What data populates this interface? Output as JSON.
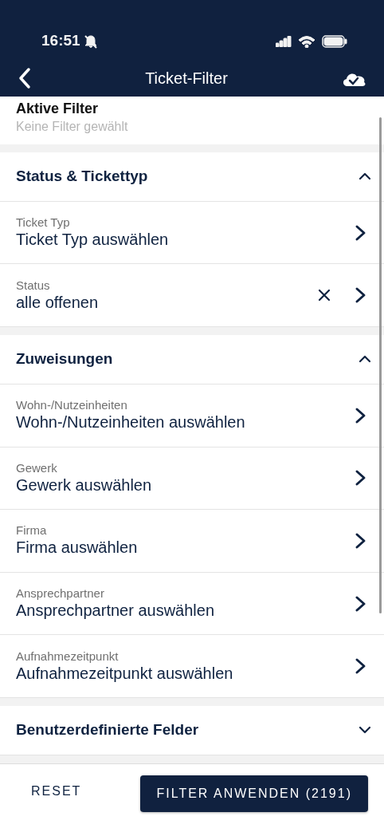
{
  "status_bar": {
    "time": "16:51",
    "muted": true
  },
  "header": {
    "title": "Ticket-Filter"
  },
  "active_filters": {
    "title": "Aktive Filter",
    "value": "Keine Filter gewählt"
  },
  "sections": [
    {
      "title": "Status & Tickettyp",
      "expanded": true,
      "items": [
        {
          "label": "Ticket Typ",
          "value": "Ticket Typ auswählen",
          "clearable": false
        },
        {
          "label": "Status",
          "value": "alle offenen",
          "clearable": true
        }
      ]
    },
    {
      "title": "Zuweisungen",
      "expanded": true,
      "items": [
        {
          "label": "Wohn-/Nutzeinheiten",
          "value": "Wohn-/Nutzeinheiten auswählen",
          "clearable": false
        },
        {
          "label": "Gewerk",
          "value": "Gewerk auswählen",
          "clearable": false
        },
        {
          "label": "Firma",
          "value": "Firma auswählen",
          "clearable": false
        },
        {
          "label": "Ansprechpartner",
          "value": "Ansprechpartner auswählen",
          "clearable": false
        },
        {
          "label": "Aufnahmezeitpunkt",
          "value": "Aufnahmezeitpunkt auswählen",
          "clearable": false
        }
      ]
    },
    {
      "title": "Benutzerdefinierte Felder",
      "expanded": false
    }
  ],
  "footer": {
    "reset": "RESET",
    "apply": "FILTER ANWENDEN (2191)"
  }
}
